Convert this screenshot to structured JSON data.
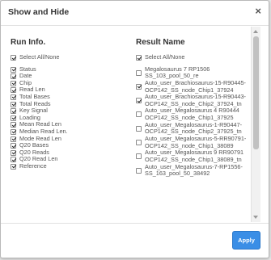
{
  "dialog": {
    "title": "Show and Hide",
    "close_label": "×",
    "apply_label": "Apply"
  },
  "left_column": {
    "title": "Run Info.",
    "select_all": {
      "label": "Select All/None",
      "checked": true
    },
    "items": [
      {
        "label": "Status",
        "checked": true
      },
      {
        "label": "Date",
        "checked": true
      },
      {
        "label": "Chip",
        "checked": true
      },
      {
        "label": "Read Len",
        "checked": true
      },
      {
        "label": "Total Bases",
        "checked": true
      },
      {
        "label": "Total Reads",
        "checked": true
      },
      {
        "label": "Key Signal",
        "checked": true
      },
      {
        "label": "Loading",
        "checked": true
      },
      {
        "label": "Mean Read Len",
        "checked": true
      },
      {
        "label": "Median Read Len.",
        "checked": true
      },
      {
        "label": "Mode Read Len",
        "checked": true
      },
      {
        "label": "Q20 Bases",
        "checked": true
      },
      {
        "label": "Q20 Reads",
        "checked": true
      },
      {
        "label": "Q20 Read Len",
        "checked": true
      },
      {
        "label": "Reference",
        "checked": true
      }
    ]
  },
  "right_column": {
    "title": "Result Name",
    "select_all": {
      "label": "Select All/None",
      "checked": true
    },
    "items": [
      {
        "line1": "Megalosaurus 7 RP1506",
        "line2": "SS_103_pool_50_re",
        "checked": false
      },
      {
        "line1": "Auto_user_Brachiosaurus-15-R90445-",
        "line2": "OCP142_SS_node_Chip1_37924",
        "checked": true
      },
      {
        "line1": "Auto_user_Brachiosaurus-15-R90443-",
        "line2": "OCP142_SS_node_Chip2_37924_tn",
        "checked": true
      },
      {
        "line1": "Auto_user_Megalosaurus 4 R90444",
        "line2": "OCP142_SS_node_Chip1_37925",
        "checked": false
      },
      {
        "line1": "Auto_user_Megalosaurus-1-R90447-",
        "line2": "OCP142_SS_node_Chip2_37925_tn",
        "checked": false
      },
      {
        "line1": "Auto_user_Megalosaurus-5-RR90791-",
        "line2": "OCP142_SS_node_Chip1_38089",
        "checked": false
      },
      {
        "line1": "Auto_user_Megalosaurus 9 RR90791",
        "line2": "OCP142_SS_node_Chip1_38089_tn",
        "checked": false
      },
      {
        "line1": "Auto_user_Megalosaurus-7-RP1556-",
        "line2": "SS_163_pool_50_38492",
        "checked": false
      }
    ]
  }
}
